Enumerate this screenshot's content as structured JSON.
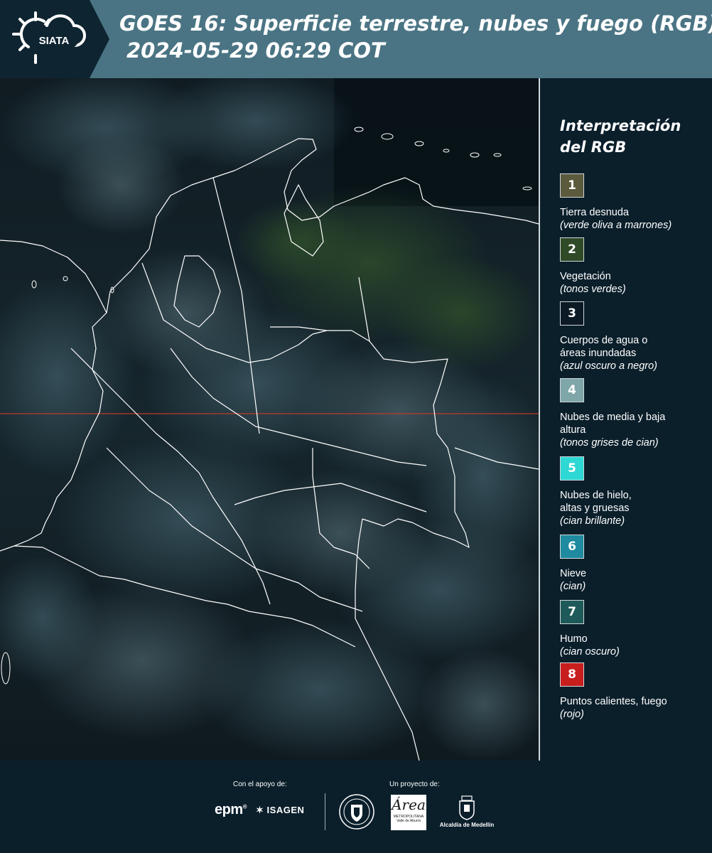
{
  "header": {
    "logo_text": "SIATA",
    "title_line1": "GOES 16: Superficie terrestre, nubes y fuego (RGB)",
    "title_line2": "2024-05-29 06:29 COT",
    "colors": {
      "left_panel": "#0e2431",
      "right_panel": "#4a7484"
    }
  },
  "legend": {
    "title_line1": "Interpretación",
    "title_line2": "del RGB",
    "items": [
      {
        "number": "1",
        "label": "Tierra desnuda",
        "sub": "(verde oliva a marrones)",
        "color": "#5b5a3d"
      },
      {
        "number": "2",
        "label": "Vegetación",
        "sub": "(tonos verdes)",
        "color": "#2f4a26"
      },
      {
        "number": "3",
        "label": "Cuerpos de agua o áreas inundadas",
        "sub": "(azul oscuro a negro)",
        "color": "#0b1a24"
      },
      {
        "number": "4",
        "label": "Nubes de media y baja altura",
        "sub": "(tonos grises de cian)",
        "color": "#7fa6a8"
      },
      {
        "number": "5",
        "label": "Nubes de hielo, altas y gruesas",
        "sub": "(cian brillante)",
        "color": "#2ed8d4"
      },
      {
        "number": "6",
        "label": "Nieve",
        "sub": "(cian)",
        "color": "#1f8aa0"
      },
      {
        "number": "7",
        "label": "Humo",
        "sub": "(cian oscuro)",
        "color": "#1f5a5a"
      },
      {
        "number": "8",
        "label": "Puntos calientes, fuego",
        "sub": "(rojo)",
        "color": "#c81e1e"
      }
    ]
  },
  "footer": {
    "support_label": "Con el apoyo de:",
    "project_label": "Un proyecto de:",
    "epm_text": "epm",
    "epm_mark": "®",
    "isagen_text": "ISAGEN",
    "amva_big": "Área",
    "amva_small": "METROPOLITANA",
    "amva_tagline": "Valle de Aburrá",
    "alcaldia_text": "Alcaldía de Medellín"
  },
  "map": {
    "equator_color": "#c0392b",
    "border_color": "#ffffff",
    "icons": [
      "sun-cloud-icon",
      "shield-seal-icon"
    ]
  }
}
